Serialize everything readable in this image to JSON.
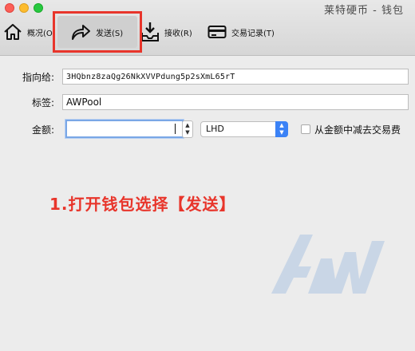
{
  "window": {
    "title": "莱特硬币 - 钱包"
  },
  "toolbar": {
    "overview_label": "概况(O",
    "send_label": "发送(S)",
    "receive_label": "接收(R)",
    "history_label": "交易记录(T)"
  },
  "form": {
    "payto_label": "指向给:",
    "payto_value": "3HQbnz8zaQg26NkXVVPdung5p2sXmL65rT",
    "label_label": "标签:",
    "label_value": "AWPool",
    "amount_label": "金额:",
    "amount_value": "",
    "unit_value": "LHD",
    "subtract_fee_label": "从金额中减去交易费"
  },
  "annotation": {
    "text": "1.打开钱包选择【发送】",
    "color": "#e8352b"
  },
  "icons": {
    "overview": "home-icon",
    "send": "send-arrow-icon",
    "receive": "receive-tray-icon",
    "history": "card-icon"
  },
  "colors": {
    "highlight": "#e8352b",
    "select_accent": "#3b82f6"
  }
}
